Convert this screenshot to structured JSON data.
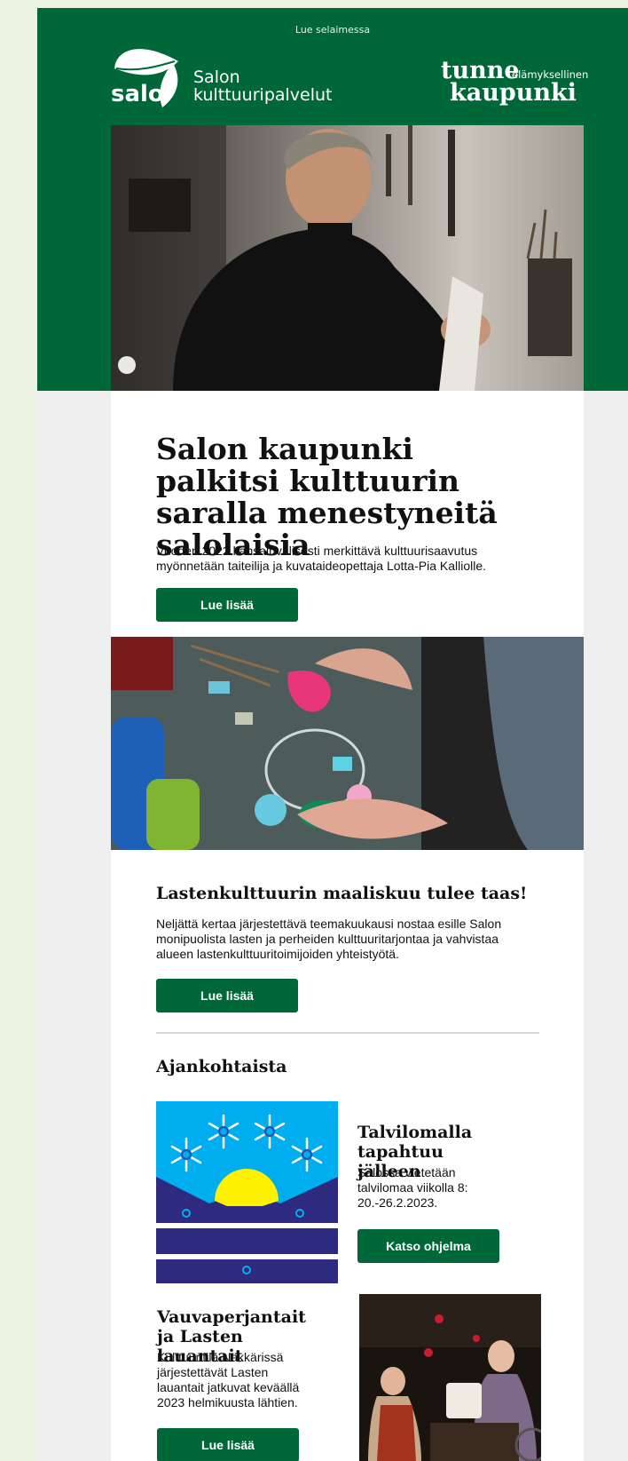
{
  "header": {
    "view_in_browser": "Lue selaimessa",
    "logo_left": {
      "wordmark": "salo",
      "line1": "Salon",
      "line2": "kulttuuripalvelut"
    },
    "logo_right": {
      "word1": "tunne",
      "tagline": "elämyksellinen",
      "word2": "kaupunki"
    }
  },
  "article1": {
    "title": "Salon kaupunki palkitsi kulttuurin saralla menestyneitä salolaisia",
    "body": "Vuoden 2022 kansainvälisesti merkittävä kulttuurisaavutus myönnetään taiteilija ja kuvataideopettaja Lotta-Pia Kalliolle.",
    "button": "Lue lisää"
  },
  "article2": {
    "title": "Lastenkulttuurin maaliskuu tulee taas!",
    "body": "Neljättä kertaa järjestettävä teemakuukausi nostaa esille Salon monipuolista lasten ja perheiden kulttuuritarjontaa ja vahvistaa alueen lastenkulttuuritoimijoiden yhteistyötä.",
    "button": "Lue lisää"
  },
  "news": {
    "heading": "Ajankohtaista",
    "item1": {
      "title": "Talvilomalla tapahtuu jälleen",
      "body": "Salossa vietetään talvilomaa viikolla 8: 20.-26.2.2023.",
      "button": "Katso ohjelma"
    },
    "item2": {
      "title": "Vauvaperjantait ja Lasten lauantait",
      "body": "Kulttuuritila Näkkärissä järjestettävät Lasten lauantait jatkuvat keväällä 2023 helmikuusta lähtien.",
      "button": "Lue lisää"
    }
  },
  "colors": {
    "brand_green": "#006838",
    "page_bg": "#ebf3e2",
    "winter_sky": "#00aeef",
    "winter_ground": "#2e2a7f",
    "winter_sun": "#fff200"
  }
}
